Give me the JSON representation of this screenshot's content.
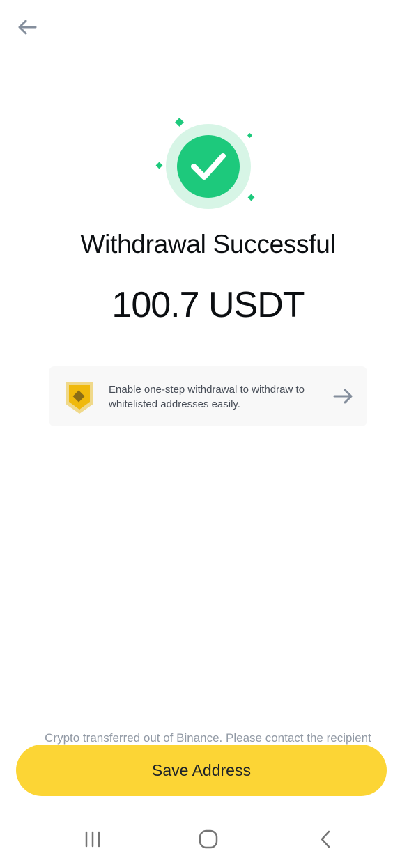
{
  "header": {
    "back_icon": "arrow-left-icon"
  },
  "result": {
    "icon": "success-check-icon",
    "title": "Withdrawal Successful",
    "amount": "100.7 USDT",
    "accent_color": "#1dc97c"
  },
  "promo": {
    "icon": "shield-badge-icon",
    "text": "Enable one-step withdrawal to withdraw to whitelisted addresses easily.",
    "arrow_icon": "arrow-right-icon"
  },
  "footer": {
    "note": "Crypto transferred out of Binance. Please contact the recipient",
    "save_button_label": "Save Address",
    "button_color": "#fcd535"
  },
  "system_nav": {
    "recents_icon": "recents-icon",
    "home_icon": "home-icon",
    "back_icon": "chevron-left-icon"
  }
}
